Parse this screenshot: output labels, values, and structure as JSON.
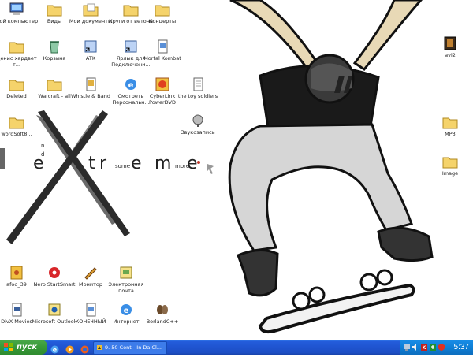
{
  "desktop": {
    "icons": [
      {
        "id": "my-computer",
        "label": "Мой компьютер",
        "type": "computer"
      },
      {
        "id": "vidy",
        "label": "Виды",
        "type": "folder"
      },
      {
        "id": "my-documents",
        "label": "Мои документы",
        "type": "docs"
      },
      {
        "id": "krugi",
        "label": "Круги от ветона",
        "type": "folder"
      },
      {
        "id": "concerts",
        "label": "Концерты",
        "type": "folder"
      },
      {
        "id": "folder-denis",
        "label": "Денис хардвет т...",
        "type": "folder"
      },
      {
        "id": "recycle-bin",
        "label": "Корзина",
        "type": "recycle"
      },
      {
        "id": "atk",
        "label": "ATK",
        "type": "shortcut"
      },
      {
        "id": "shortcut-connection",
        "label": "Ярлык для Подключени...",
        "type": "shortcut"
      },
      {
        "id": "mortal-kombat",
        "label": "Mortal Kombat",
        "type": "doc"
      },
      {
        "id": "deleted",
        "label": "Deleted",
        "type": "folder"
      },
      {
        "id": "warcraft",
        "label": "Warcraft - all",
        "type": "folder"
      },
      {
        "id": "whistle-band",
        "label": "Whistle & Band",
        "type": "shortcut"
      },
      {
        "id": "internet-explorer",
        "label": "Смотреть Персональн...",
        "type": "ie"
      },
      {
        "id": "cyberlink",
        "label": "CyberLink PowerDVD",
        "type": "dvd"
      },
      {
        "id": "toy-soldiers",
        "label": "the toy soldiers",
        "type": "notepad"
      },
      {
        "id": "folder-wordsoft",
        "label": "wordSoft8...",
        "type": "folder"
      },
      {
        "id": "sound-recorder",
        "label": "Звукозапись",
        "type": "sound"
      },
      {
        "id": "mp3",
        "label": "MP3",
        "type": "folder"
      },
      {
        "id": "image",
        "label": "Image",
        "type": "folder"
      },
      {
        "id": "avi2",
        "label": "avi2",
        "type": "video"
      },
      {
        "id": "jpeg39",
        "label": "afoo_39",
        "type": "image"
      },
      {
        "id": "nero",
        "label": "Nero StartSmart",
        "type": "nero"
      },
      {
        "id": "monitor",
        "label": "Монитор",
        "type": "shortcut"
      },
      {
        "id": "email",
        "label": "Электронная почта",
        "type": "mail"
      },
      {
        "id": "divx",
        "label": "DivX Movies",
        "type": "shortcut"
      },
      {
        "id": "outlook",
        "label": "Microsoft Outlook",
        "type": "mail"
      },
      {
        "id": "contacts",
        "label": "КОНЕЧНЫЙ",
        "type": "shortcut"
      },
      {
        "id": "internet",
        "label": "Интернет",
        "type": "ie"
      },
      {
        "id": "borland",
        "label": "BorlandC++",
        "type": "borland"
      }
    ]
  },
  "wallpaper": {
    "big_letter": "X",
    "word": [
      "e",
      "t",
      "r",
      "e",
      "m",
      "e"
    ],
    "small_words": [
      "need",
      "some",
      "more"
    ],
    "small_letter_n": "n",
    "small_letter_d": "d"
  },
  "taskbar": {
    "start_label": "пуск",
    "quick_launch": [
      "ie-icon",
      "media-player-icon",
      "firefox-icon"
    ],
    "tasks": [
      {
        "label": "9. 50 Cent - In Da Cl..."
      }
    ],
    "tray_icons": [
      "network-icon",
      "sound-icon",
      "language-icon",
      "antivirus-icon",
      "security-icon"
    ],
    "clock": "5:37"
  },
  "colors": {
    "taskbar": "#245ddb",
    "start": "#379937",
    "tray": "#0f7fd6"
  }
}
